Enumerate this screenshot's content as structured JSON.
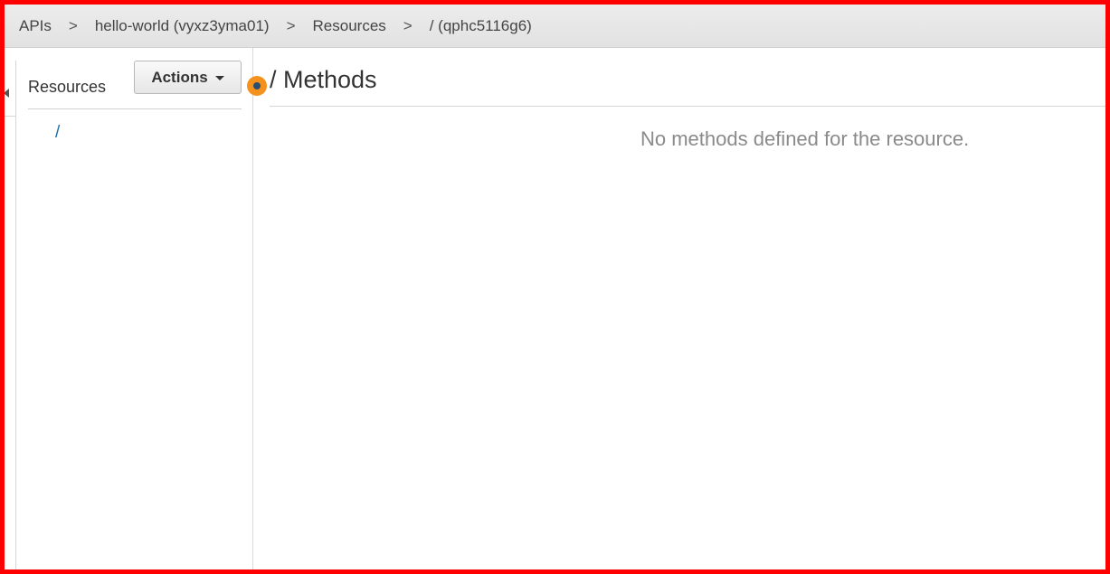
{
  "breadcrumb": {
    "items": [
      "APIs",
      "hello-world (vyxz3yma01)",
      "Resources",
      "/ (qphc5116g6)"
    ],
    "separator": ">"
  },
  "resources_panel": {
    "title": "Resources",
    "actions_label": "Actions",
    "tree": [
      {
        "label": "/"
      }
    ]
  },
  "main": {
    "title": "/ Methods",
    "empty_message": "No methods defined for the resource."
  },
  "colors": {
    "frame_border": "#ff0000",
    "link": "#1f6ea7",
    "status_dot": "#f5921e"
  }
}
